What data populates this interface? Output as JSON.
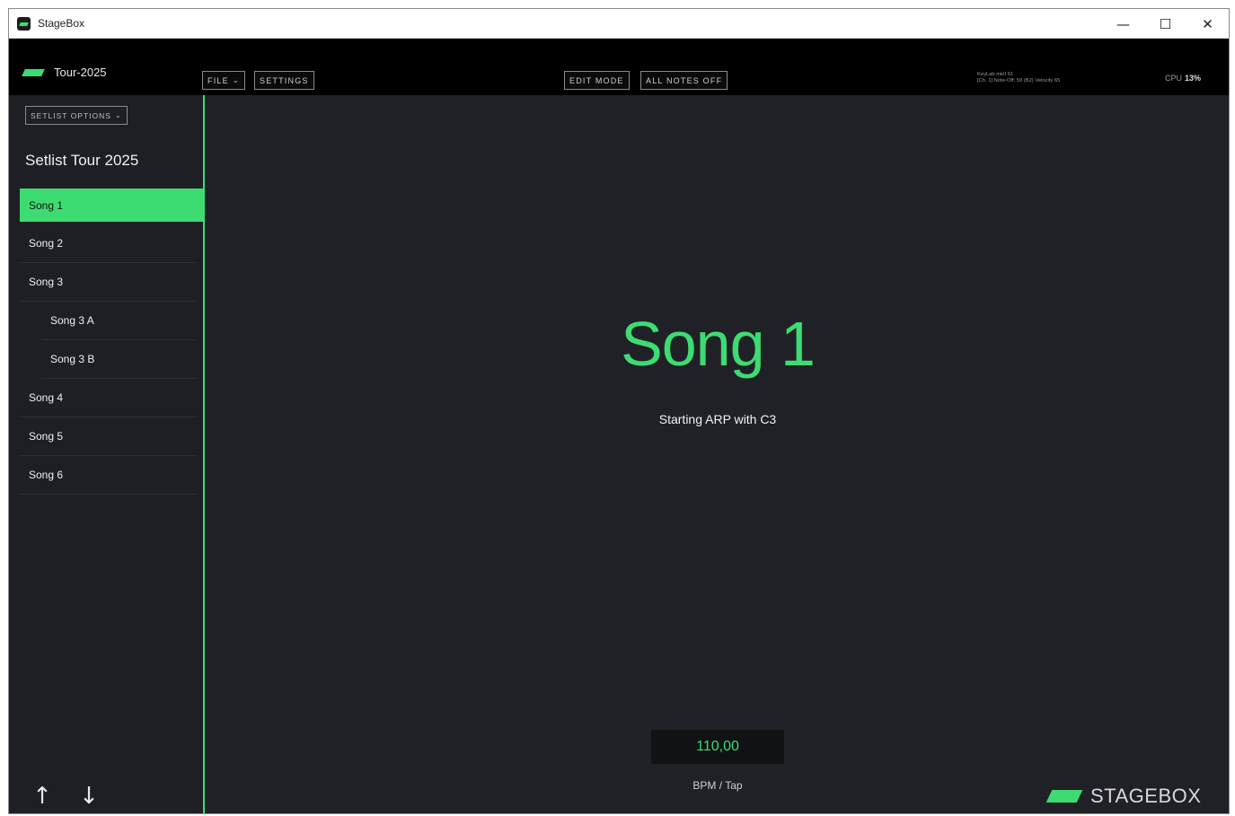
{
  "window": {
    "title": "StageBox",
    "controls": {
      "minimize": "—",
      "maximize": "☐",
      "close": "✕"
    }
  },
  "toolbar": {
    "brand_name": "Tour-2025",
    "file_label": "FILE",
    "settings_label": "SETTINGS",
    "edit_mode_label": "EDIT MODE",
    "all_notes_off_label": "ALL NOTES OFF",
    "device_line1": "KeyLab mkII 61",
    "device_line2": "[Ch. 1] Note-Off: 59 (B2) Velocity 65",
    "cpu_label": "CPU",
    "cpu_value": "13%"
  },
  "sidebar": {
    "setlist_options_label": "SETLIST OPTIONS",
    "setlist_title": "Setlist Tour 2025",
    "songs": [
      {
        "label": "Song 1"
      },
      {
        "label": "Song 2"
      },
      {
        "label": "Song 3"
      },
      {
        "label": "Song 3 A"
      },
      {
        "label": "Song 3 B"
      },
      {
        "label": "Song 4"
      },
      {
        "label": "Song 5"
      },
      {
        "label": "Song 6"
      }
    ],
    "nav": {
      "up": "↑",
      "down": "↓"
    }
  },
  "main": {
    "song_title": "Song 1",
    "song_note": "Starting ARP with C3",
    "bpm_value": "110,00",
    "bpm_label": "BPM / Tap",
    "logo_text": "STAGEBOX"
  },
  "colors": {
    "accent": "#3ddc72",
    "background": "#202126",
    "toolbar": "#000000",
    "sidebar": "#1e1f24"
  }
}
